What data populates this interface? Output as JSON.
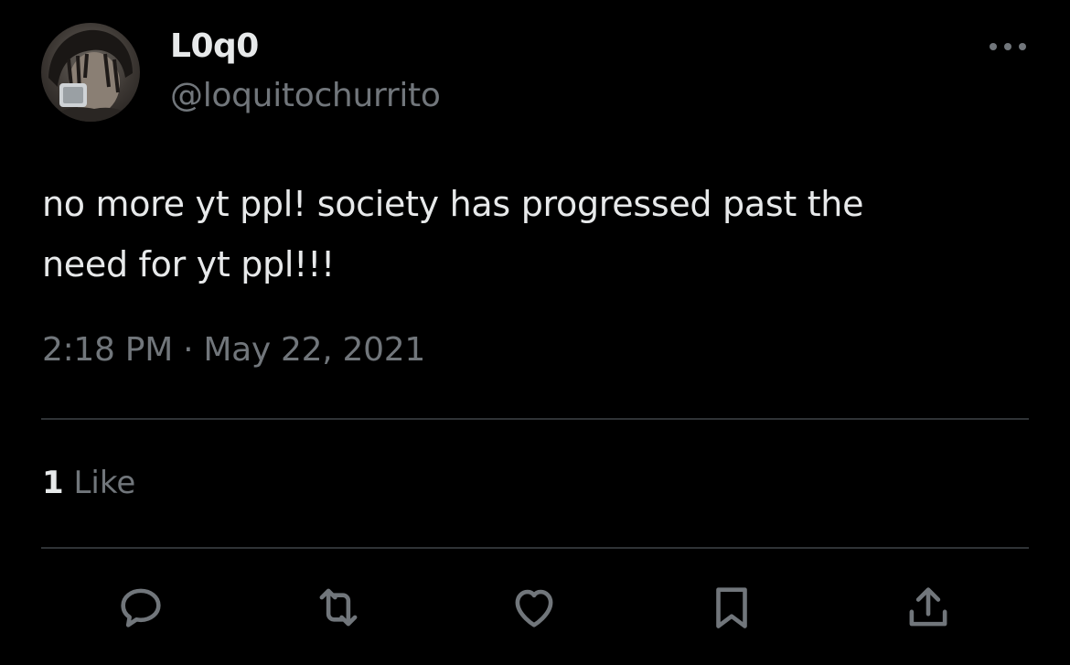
{
  "tweet": {
    "author": {
      "display_name": "L0q0",
      "handle": "@loquitochurrito"
    },
    "text_line1": "no more yt ppl! society has progressed past the",
    "text_line2": "need for yt ppl!!!",
    "timestamp": "2:18 PM · May 22, 2021",
    "likes_count": "1",
    "likes_label": " Like"
  },
  "icons": {
    "more": "more-horizontal-icon",
    "reply": "reply-icon",
    "retweet": "retweet-icon",
    "like": "heart-icon",
    "bookmark": "bookmark-icon",
    "share": "share-icon"
  },
  "colors": {
    "background": "#000000",
    "primary_text": "#e7e9ea",
    "secondary_text": "#71767b",
    "divider": "#2f3336"
  }
}
